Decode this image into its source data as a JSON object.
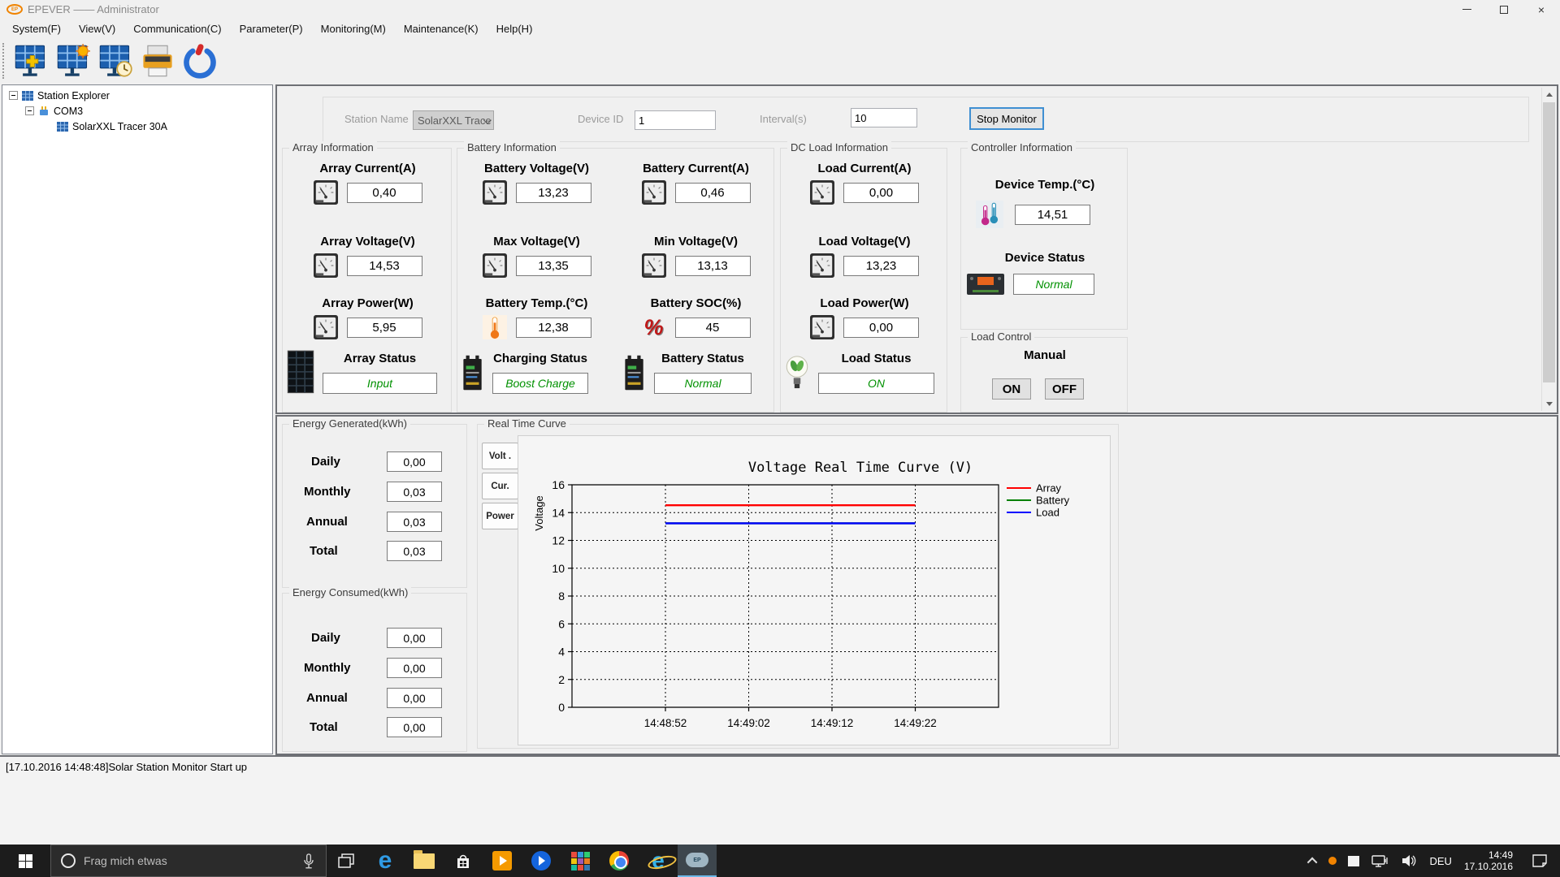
{
  "window": {
    "title": "EPEVER —— Administrator"
  },
  "menu": [
    "System(F)",
    "View(V)",
    "Communication(C)",
    "Parameter(P)",
    "Monitoring(M)",
    "Maintenance(K)",
    "Help(H)"
  ],
  "tree": {
    "root": "Station Explorer",
    "port": "COM3",
    "device": "SolarXXL Tracer 30A"
  },
  "settings": {
    "station_name_label": "Station Name",
    "station_name_value": "SolarXXL Trace",
    "device_id_label": "Device ID",
    "device_id_value": "1",
    "interval_label": "Interval(s)",
    "interval_value": "10",
    "stop_button_label": "Stop Monitor"
  },
  "array_info": {
    "title": "Array Information",
    "fields": [
      {
        "label": "Array Current(A)",
        "value": "0,40"
      },
      {
        "label": "Array Voltage(V)",
        "value": "14,53"
      },
      {
        "label": "Array Power(W)",
        "value": "5,95"
      }
    ],
    "status": {
      "label": "Array Status",
      "value": "Input"
    }
  },
  "battery_info": {
    "title": "Battery Information",
    "fields": [
      {
        "label": "Battery Voltage(V)",
        "value": "13,23"
      },
      {
        "label": "Battery Current(A)",
        "value": "0,46"
      },
      {
        "label": "Max Voltage(V)",
        "value": "13,35"
      },
      {
        "label": "Min Voltage(V)",
        "value": "13,13"
      },
      {
        "label": "Battery Temp.(°C)",
        "value": "12,38"
      },
      {
        "label": "Battery SOC(%)",
        "value": "45"
      }
    ],
    "statuses": [
      {
        "label": "Charging Status",
        "value": "Boost Charge"
      },
      {
        "label": "Battery Status",
        "value": "Normal"
      }
    ]
  },
  "load_info": {
    "title": "DC Load Information",
    "fields": [
      {
        "label": "Load Current(A)",
        "value": "0,00"
      },
      {
        "label": "Load Voltage(V)",
        "value": "13,23"
      },
      {
        "label": "Load Power(W)",
        "value": "0,00"
      }
    ],
    "status": {
      "label": "Load Status",
      "value": "ON"
    }
  },
  "controller_info": {
    "title": "Controller Information",
    "temp": {
      "label": "Device Temp.(°C)",
      "value": "14,51"
    },
    "status": {
      "label": "Device Status",
      "value": "Normal"
    }
  },
  "load_control": {
    "title": "Load Control",
    "mode_label": "Manual",
    "on_label": "ON",
    "off_label": "OFF"
  },
  "energy_generated": {
    "title": "Energy Generated(kWh)",
    "rows": [
      {
        "label": "Daily",
        "value": "0,00"
      },
      {
        "label": "Monthly",
        "value": "0,03"
      },
      {
        "label": "Annual",
        "value": "0,03"
      },
      {
        "label": "Total",
        "value": "0,03"
      }
    ]
  },
  "energy_consumed": {
    "title": "Energy Consumed(kWh)",
    "rows": [
      {
        "label": "Daily",
        "value": "0,00"
      },
      {
        "label": "Monthly",
        "value": "0,00"
      },
      {
        "label": "Annual",
        "value": "0,00"
      },
      {
        "label": "Total",
        "value": "0,00"
      }
    ]
  },
  "curve": {
    "title": "Real Time Curve",
    "tabs": [
      "Volt .",
      "Cur.",
      "Power"
    ]
  },
  "chart_data": {
    "type": "line",
    "title": "Voltage Real Time Curve (V)",
    "ylabel": "Voltage",
    "ylim": [
      0,
      16
    ],
    "ytick_step": 2,
    "x_ticks": [
      "14:48:52",
      "14:49:02",
      "14:49:12",
      "14:49:22"
    ],
    "series": [
      {
        "name": "Array",
        "color": "#ff0000",
        "values": [
          14.53,
          14.53,
          14.53,
          14.53
        ]
      },
      {
        "name": "Battery",
        "color": "#008000",
        "values": [
          13.23,
          13.23,
          13.23,
          13.23
        ]
      },
      {
        "name": "Load",
        "color": "#0000ff",
        "values": [
          13.23,
          13.23,
          13.23,
          13.23
        ]
      }
    ],
    "legend_position": "right",
    "grid": true
  },
  "log": {
    "text": "[17.10.2016 14:48:48]Solar Station Monitor Start up"
  },
  "taskbar": {
    "search_placeholder": "Frag mich etwas",
    "language": "DEU",
    "time": "14:49",
    "date": "17.10.2016"
  },
  "icons": {
    "percent_icon": "%",
    "close_icon": "×"
  }
}
